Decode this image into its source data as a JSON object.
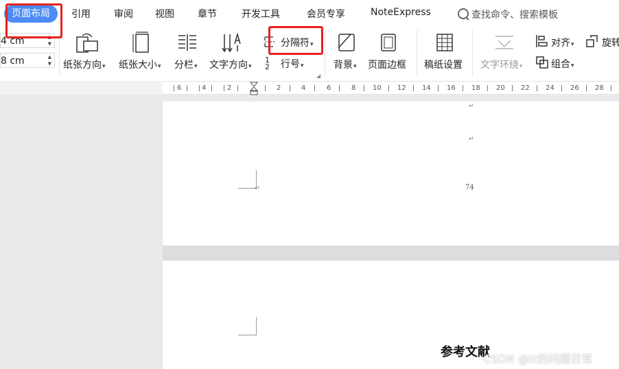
{
  "menu": {
    "tabs": [
      "页面布局",
      "引用",
      "审阅",
      "视图",
      "章节",
      "开发工具",
      "会员专享",
      "NoteExpress"
    ],
    "search_placeholder": "查找命令、搜索模板"
  },
  "ribbon": {
    "margin_top_value": "4 cm",
    "margin_bottom_value": "8 cm",
    "paper_orientation": "纸张方向",
    "paper_size": "纸张大小",
    "columns": "分栏",
    "text_direction": "文字方向",
    "breaks": "分隔符",
    "line_numbers": "行号",
    "background": "背景",
    "page_borders": "页面边框",
    "manuscript": "稿纸设置",
    "text_wrap": "文字环绕",
    "align": "对齐",
    "rotate": "旋转",
    "group": "组合"
  },
  "ruler": {
    "labels": [
      "6",
      "4",
      "2",
      "2",
      "4",
      "6",
      "8",
      "10",
      "12",
      "14",
      "16",
      "18",
      "20",
      "22",
      "24",
      "26",
      "28"
    ]
  },
  "document": {
    "page_number": "74",
    "heading": "参考文献",
    "watermark": "CSDN @tt的问题日常"
  },
  "colors": {
    "accent": "#4d8bf5",
    "highlight": "#e8201c"
  }
}
